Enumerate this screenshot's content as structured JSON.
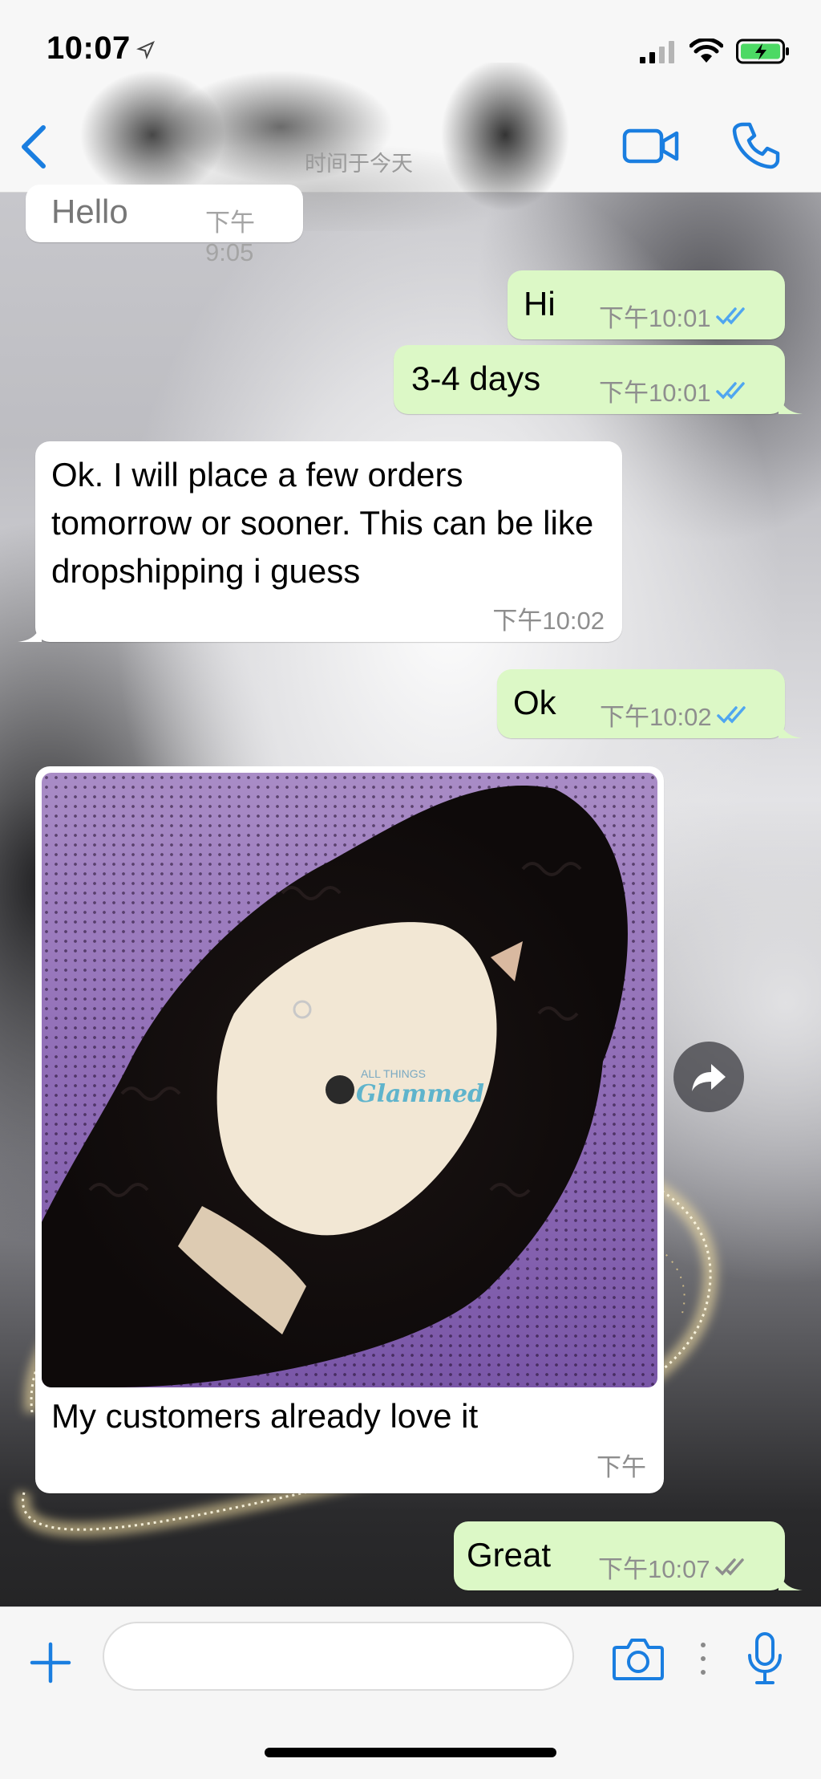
{
  "status_bar": {
    "time": "10:07",
    "icons": [
      "location-arrow-icon",
      "cellular-signal-icon",
      "wifi-icon",
      "battery-charging-icon"
    ]
  },
  "header": {
    "contact_subtitle": "时间于今天",
    "icons": [
      "chevron-left-icon",
      "video-camera-icon",
      "phone-icon"
    ]
  },
  "messages": [
    {
      "direction": "in",
      "text": "Hello",
      "time": "下午9:05"
    },
    {
      "direction": "out",
      "text": "Hi",
      "time": "下午10:01",
      "status": "read"
    },
    {
      "direction": "out",
      "text": "3-4 days",
      "time": "下午10:01",
      "status": "read"
    },
    {
      "direction": "in",
      "text": "Ok. I will place a few orders tomorrow or sooner. This can be like dropshipping i guess",
      "time": "下午10:02"
    },
    {
      "direction": "out",
      "text": "Ok",
      "time": "下午10:02",
      "status": "read"
    },
    {
      "direction": "in",
      "type": "photo",
      "caption": "My customers already love it",
      "time": "下午",
      "photo_watermark": [
        "ALL THINGS",
        "Glammed"
      ]
    },
    {
      "direction": "out",
      "text": "Great",
      "time": "下午10:07",
      "status": "delivered"
    }
  ],
  "colors": {
    "accent": "#1a7ee0",
    "outgoing_bubble": "#dcf8c6",
    "incoming_bubble": "#ffffff",
    "read_ticks": "#4fa6f0",
    "delivered_ticks": "#8e8e8e"
  },
  "input_bar": {
    "placeholder": "",
    "icons": [
      "plus-icon",
      "camera-icon",
      "microphone-icon"
    ]
  }
}
